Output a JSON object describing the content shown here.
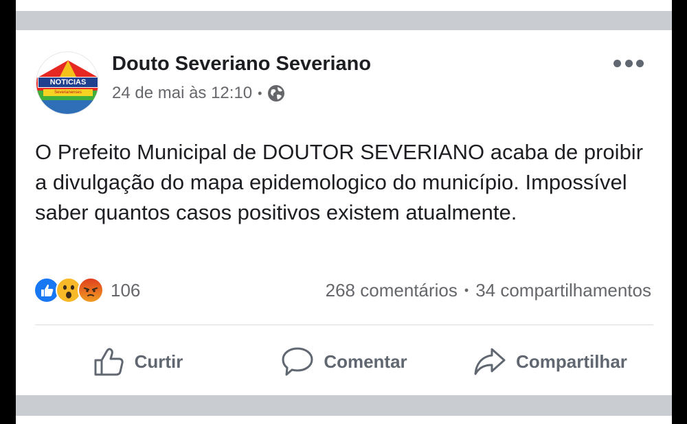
{
  "post": {
    "author": "Douto Severiano Severiano",
    "avatar_text_top": "NOTICIAS",
    "avatar_text_bottom": "Severianenses",
    "timestamp": "24 de mai às 12:10",
    "separator": "•",
    "privacy_icon": "globe-icon",
    "text": "O Prefeito Municipal de DOUTOR SEVERIANO acaba de proibir a divulgação do mapa epidemologico do município. Impossível saber quantos casos positivos existem atualmente.",
    "reactions": {
      "icons": [
        "like-icon",
        "wow-icon",
        "angry-icon"
      ],
      "count": "106"
    },
    "stats": {
      "comments": "268 comentários",
      "separator": "•",
      "shares": "34 compartilhamentos"
    },
    "actions": {
      "like": "Curtir",
      "comment": "Comentar",
      "share": "Compartilhar"
    }
  },
  "colors": {
    "like_blue": "#1877f2",
    "wow_yellow": "#f7b928",
    "angry_orange": "#e9710f",
    "secondary_text": "#65676b",
    "separator_gray": "#c9ccd1"
  }
}
